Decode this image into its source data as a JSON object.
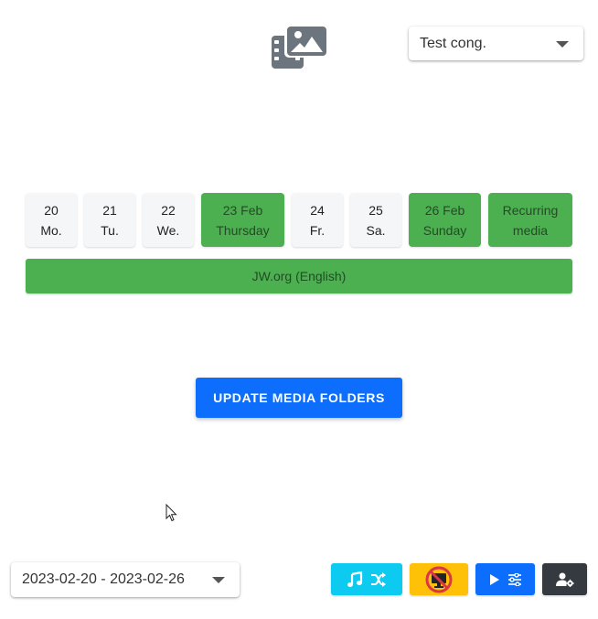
{
  "congregation_select": {
    "value": "Test cong."
  },
  "days": [
    {
      "line1": "20",
      "line2": "Mo."
    },
    {
      "line1": "21",
      "line2": "Tu."
    },
    {
      "line1": "22",
      "line2": "We."
    },
    {
      "line1": "23 Feb",
      "line2": "Thursday"
    },
    {
      "line1": "24",
      "line2": "Fr."
    },
    {
      "line1": "25",
      "line2": "Sa."
    },
    {
      "line1": "26 Feb",
      "line2": "Sunday"
    },
    {
      "line1": "Recurring",
      "line2": "media"
    }
  ],
  "jw_bar": {
    "label": "JW.org (English)"
  },
  "update_button": {
    "label": "UPDATE MEDIA FOLDERS"
  },
  "date_range_select": {
    "value": "2023-02-20 - 2023-02-26"
  },
  "toolbar": {
    "music_shuffle": {
      "icons": [
        "music-note-icon",
        "shuffle-icon"
      ],
      "color": "#0dcaf0"
    },
    "presentation": {
      "icons": [
        "no-display-icon"
      ],
      "color": "#ffc107"
    },
    "play_settings": {
      "icons": [
        "play-icon",
        "sliders-icon"
      ],
      "color": "#0d6efd"
    },
    "user_settings": {
      "icons": [
        "user-gear-icon"
      ],
      "color": "#343a40"
    }
  },
  "colors": {
    "green": "#4caf50",
    "primary": "#0d6efd",
    "logo": "#6c757d"
  }
}
